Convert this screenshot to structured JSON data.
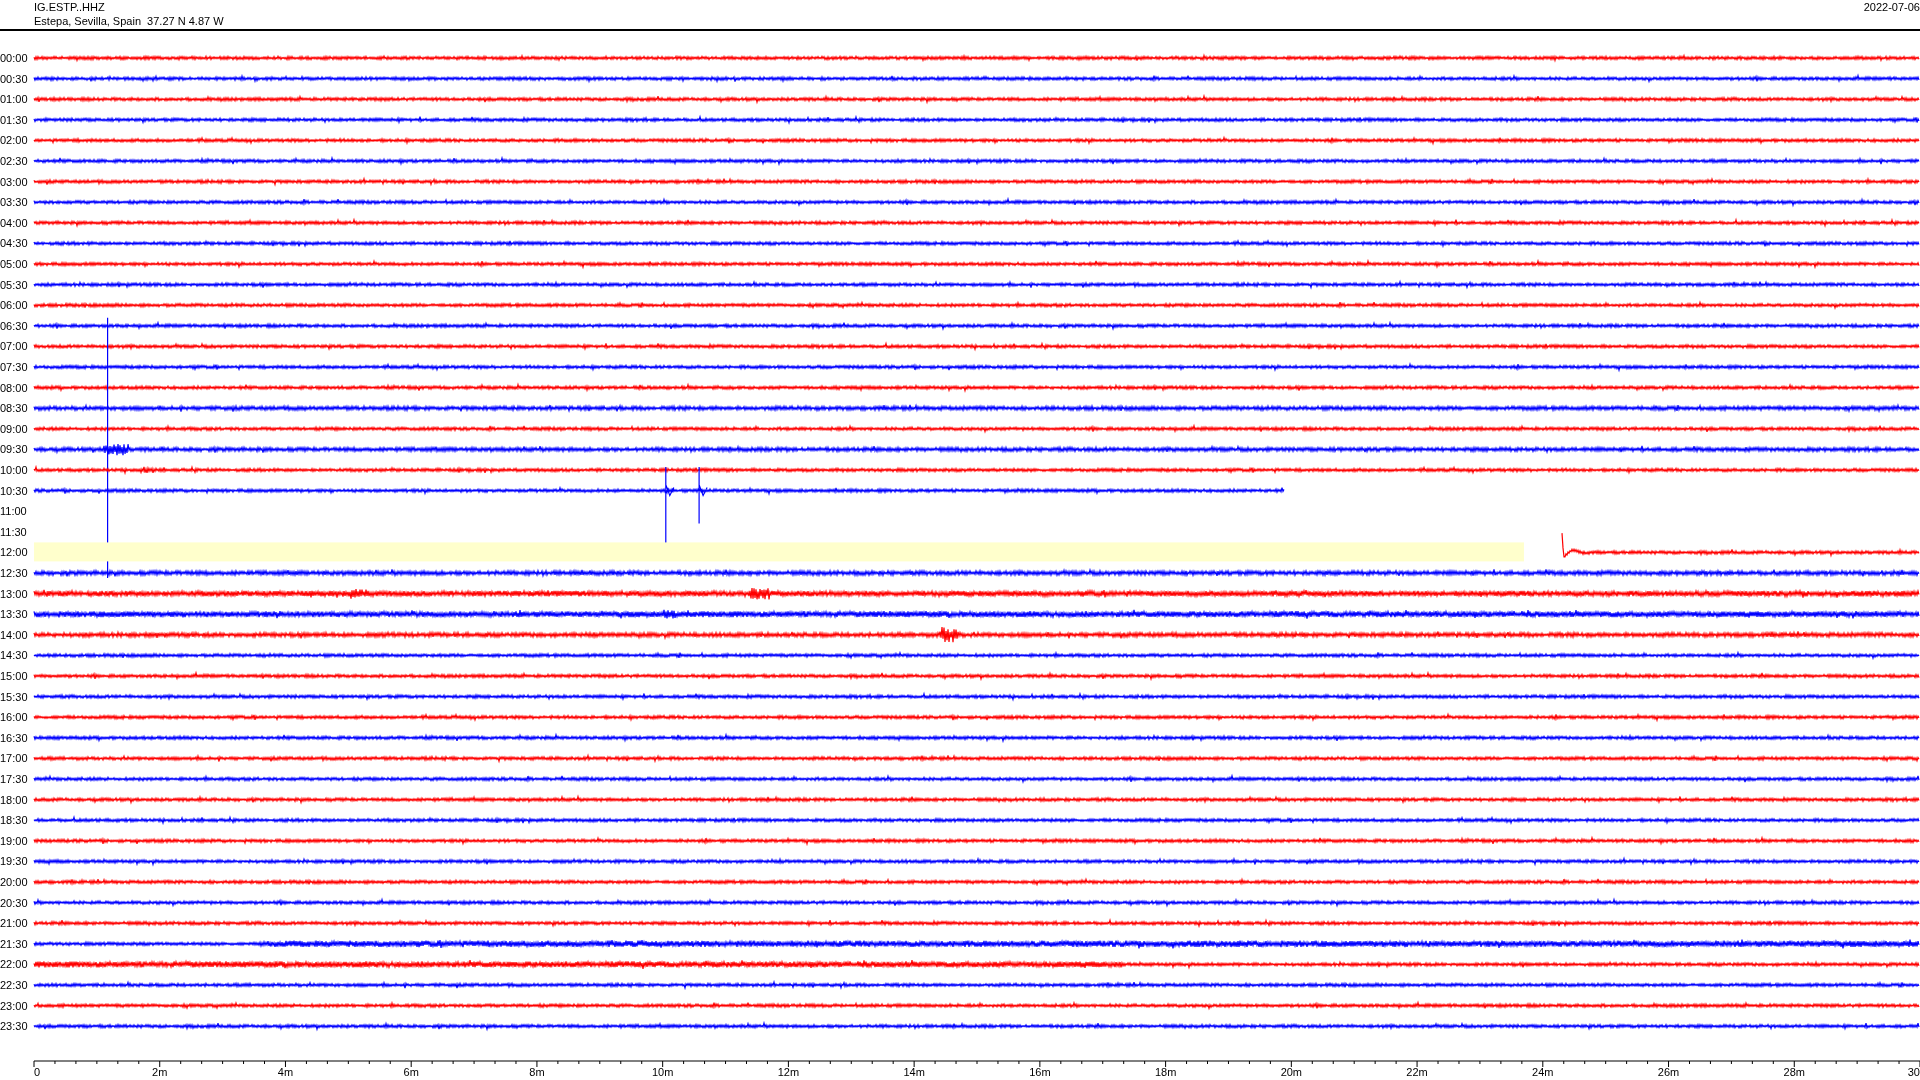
{
  "header": {
    "station": "IG.ESTP..HHZ",
    "location": "Estepa, Sevilla, Spain  37.27 N 4.87 W",
    "date": "2022-07-06"
  },
  "rows": [
    {
      "label": "00:00",
      "kind": "trace",
      "color": "#ff0000",
      "highlighted": false
    },
    {
      "label": "00:30",
      "kind": "trace",
      "color": "#0000ff",
      "highlighted": false
    },
    {
      "label": "01:00",
      "kind": "trace",
      "color": "#ff0000",
      "highlighted": false
    },
    {
      "label": "01:30",
      "kind": "trace",
      "color": "#0000ff",
      "highlighted": false
    },
    {
      "label": "02:00",
      "kind": "trace",
      "color": "#ff0000",
      "highlighted": false
    },
    {
      "label": "02:30",
      "kind": "trace",
      "color": "#0000ff",
      "highlighted": false
    },
    {
      "label": "03:00",
      "kind": "trace",
      "color": "#ff0000",
      "highlighted": false
    },
    {
      "label": "03:30",
      "kind": "trace",
      "color": "#0000ff",
      "highlighted": false
    },
    {
      "label": "04:00",
      "kind": "trace",
      "color": "#ff0000",
      "highlighted": false
    },
    {
      "label": "04:30",
      "kind": "trace",
      "color": "#0000ff",
      "highlighted": false
    },
    {
      "label": "05:00",
      "kind": "trace",
      "color": "#ff0000",
      "highlighted": false
    },
    {
      "label": "05:30",
      "kind": "trace",
      "color": "#0000ff",
      "highlighted": false
    },
    {
      "label": "06:00",
      "kind": "trace",
      "color": "#ff0000",
      "highlighted": false
    },
    {
      "label": "06:30",
      "kind": "trace",
      "color": "#0000ff",
      "highlighted": false
    },
    {
      "label": "07:00",
      "kind": "trace",
      "color": "#ff0000",
      "highlighted": false
    },
    {
      "label": "07:30",
      "kind": "trace",
      "color": "#0000ff",
      "highlighted": false
    },
    {
      "label": "08:00",
      "kind": "trace",
      "color": "#ff0000",
      "highlighted": false
    },
    {
      "label": "08:30",
      "kind": "trace",
      "color": "#0000ff",
      "highlighted": false
    },
    {
      "label": "09:00",
      "kind": "trace",
      "color": "#ff0000",
      "highlighted": false
    },
    {
      "label": "09:30",
      "kind": "trace",
      "color": "#0000ff",
      "highlighted": false
    },
    {
      "label": "10:00",
      "kind": "trace",
      "color": "#ff0000",
      "highlighted": false
    },
    {
      "label": "10:30",
      "kind": "trace-ends",
      "color": "#0000ff",
      "highlighted": false
    },
    {
      "label": "11:00",
      "kind": "gap",
      "highlighted": false
    },
    {
      "label": "11:30",
      "kind": "gap",
      "highlighted": false
    },
    {
      "label": "12:00",
      "kind": "trace-starts",
      "color": "#ff0000",
      "highlighted": true
    },
    {
      "label": "12:30",
      "kind": "trace",
      "color": "#0000ff",
      "highlighted": false
    },
    {
      "label": "13:00",
      "kind": "trace",
      "color": "#ff0000",
      "highlighted": false
    },
    {
      "label": "13:30",
      "kind": "trace",
      "color": "#0000ff",
      "highlighted": false
    },
    {
      "label": "14:00",
      "kind": "trace",
      "color": "#ff0000",
      "highlighted": false
    },
    {
      "label": "14:30",
      "kind": "trace",
      "color": "#0000ff",
      "highlighted": false
    },
    {
      "label": "15:00",
      "kind": "trace",
      "color": "#ff0000",
      "highlighted": false
    },
    {
      "label": "15:30",
      "kind": "trace",
      "color": "#0000ff",
      "highlighted": false
    },
    {
      "label": "16:00",
      "kind": "trace",
      "color": "#ff0000",
      "highlighted": false
    },
    {
      "label": "16:30",
      "kind": "trace",
      "color": "#0000ff",
      "highlighted": false
    },
    {
      "label": "17:00",
      "kind": "trace",
      "color": "#ff0000",
      "highlighted": false
    },
    {
      "label": "17:30",
      "kind": "trace",
      "color": "#0000ff",
      "highlighted": false
    },
    {
      "label": "18:00",
      "kind": "trace",
      "color": "#ff0000",
      "highlighted": false
    },
    {
      "label": "18:30",
      "kind": "trace",
      "color": "#0000ff",
      "highlighted": false
    },
    {
      "label": "19:00",
      "kind": "trace",
      "color": "#ff0000",
      "highlighted": false
    },
    {
      "label": "19:30",
      "kind": "trace",
      "color": "#0000ff",
      "highlighted": false
    },
    {
      "label": "20:00",
      "kind": "trace",
      "color": "#ff0000",
      "highlighted": false
    },
    {
      "label": "20:30",
      "kind": "trace",
      "color": "#0000ff",
      "highlighted": false
    },
    {
      "label": "21:00",
      "kind": "trace",
      "color": "#ff0000",
      "highlighted": false
    },
    {
      "label": "21:30",
      "kind": "trace",
      "color": "#0000ff",
      "highlighted": false
    },
    {
      "label": "22:00",
      "kind": "trace",
      "color": "#ff0000",
      "highlighted": false
    },
    {
      "label": "22:30",
      "kind": "trace",
      "color": "#0000ff",
      "highlighted": false
    },
    {
      "label": "23:00",
      "kind": "trace",
      "color": "#ff0000",
      "highlighted": false
    },
    {
      "label": "23:30",
      "kind": "trace",
      "color": "#0000ff",
      "highlighted": false
    }
  ],
  "x_axis": {
    "labels": [
      "0",
      "2m",
      "4m",
      "6m",
      "8m",
      "10m",
      "12m",
      "14m",
      "16m",
      "18m",
      "20m",
      "22m",
      "24m",
      "26m",
      "28m",
      "30"
    ]
  }
}
